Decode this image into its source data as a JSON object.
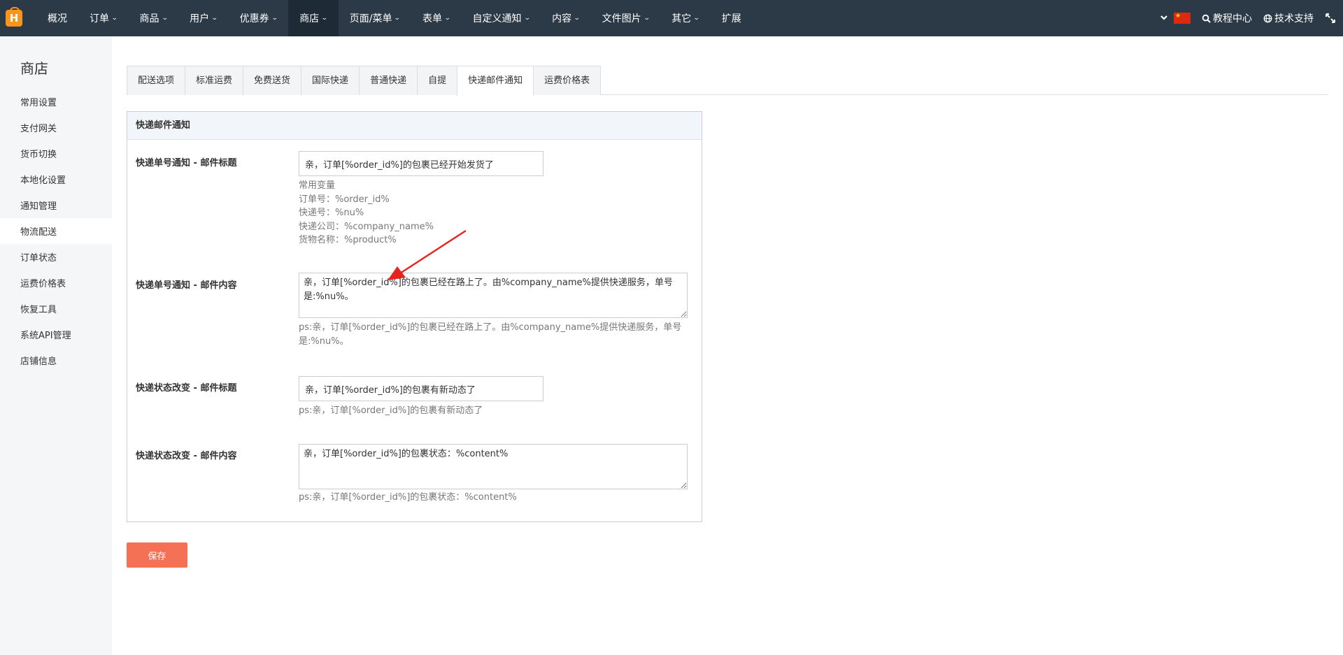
{
  "nav": {
    "items": [
      {
        "label": "概况",
        "caret": false
      },
      {
        "label": "订单",
        "caret": true
      },
      {
        "label": "商品",
        "caret": true
      },
      {
        "label": "用户",
        "caret": true
      },
      {
        "label": "优惠券",
        "caret": true
      },
      {
        "label": "商店",
        "caret": true,
        "active": true
      },
      {
        "label": "页面/菜单",
        "caret": true
      },
      {
        "label": "表单",
        "caret": true
      },
      {
        "label": "自定义通知",
        "caret": true
      },
      {
        "label": "内容",
        "caret": true
      },
      {
        "label": "文件图片",
        "caret": true
      },
      {
        "label": "其它",
        "caret": true
      },
      {
        "label": "扩展",
        "caret": false
      }
    ],
    "tutorial_label": "教程中心",
    "support_label": "技术支持"
  },
  "sidebar": {
    "title": "商店",
    "items": [
      {
        "label": "常用设置"
      },
      {
        "label": "支付网关"
      },
      {
        "label": "货币切换"
      },
      {
        "label": "本地化设置"
      },
      {
        "label": "通知管理"
      },
      {
        "label": "物流配送",
        "active": true
      },
      {
        "label": "订单状态"
      },
      {
        "label": "运费价格表"
      },
      {
        "label": "恢复工具"
      },
      {
        "label": "系统API管理"
      },
      {
        "label": "店铺信息"
      }
    ]
  },
  "tabs": [
    {
      "label": "配送选项"
    },
    {
      "label": "标准运费"
    },
    {
      "label": "免费送货"
    },
    {
      "label": "国际快递"
    },
    {
      "label": "普通快递"
    },
    {
      "label": "自提"
    },
    {
      "label": "快递邮件通知",
      "active": true
    },
    {
      "label": "运费价格表"
    }
  ],
  "panel": {
    "title": "快递邮件通知",
    "fields": {
      "tracking_subject": {
        "label": "快递单号通知 - 邮件标题",
        "value": "亲，订单[%order_id%]的包裹已经开始发货了",
        "help_lines": [
          "常用变量",
          "订单号：%order_id%",
          "快递号：%nu%",
          "快递公司：%company_name%",
          "货物名称：%product%"
        ]
      },
      "tracking_body": {
        "label": "快递单号通知 - 邮件内容",
        "value": "亲，订单[%order_id%]的包裹已经在路上了。由%company_name%提供快递服务，单号是:%nu%。",
        "help": "ps:亲，订单[%order_id%]的包裹已经在路上了。由%company_name%提供快递服务，单号是:%nu%。"
      },
      "status_subject": {
        "label": "快递状态改变 - 邮件标题",
        "value": "亲，订单[%order_id%]的包裹有新动态了",
        "help": "ps:亲，订单[%order_id%]的包裹有新动态了"
      },
      "status_body": {
        "label": "快递状态改变 - 邮件内容",
        "value": "亲，订单[%order_id%]的包裹状态：%content%",
        "help": "ps:亲，订单[%order_id%]的包裹状态：%content%"
      }
    }
  },
  "save_label": "保存",
  "colors": {
    "topbar": "#2c3a47",
    "accent": "#f47156",
    "annotation_arrow": "#e5231f"
  }
}
